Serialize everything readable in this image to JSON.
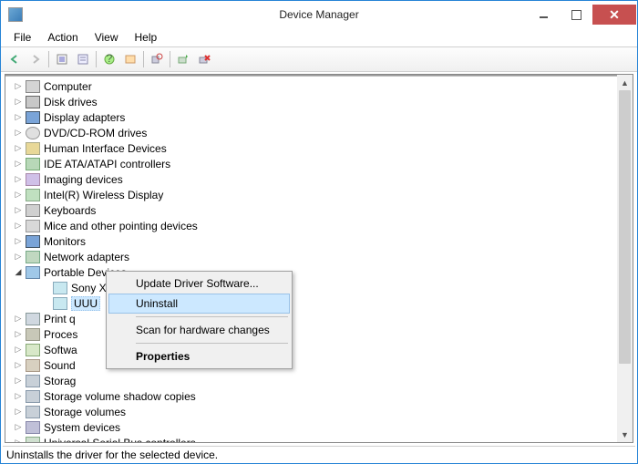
{
  "window": {
    "title": "Device Manager"
  },
  "menu": {
    "file": "File",
    "action": "Action",
    "view": "View",
    "help": "Help"
  },
  "tree": {
    "items": [
      {
        "label": "Computer",
        "icon": "ic-comp",
        "level": 0,
        "expanded": false
      },
      {
        "label": "Disk drives",
        "icon": "ic-disk",
        "level": 0,
        "expanded": false
      },
      {
        "label": "Display adapters",
        "icon": "ic-disp",
        "level": 0,
        "expanded": false
      },
      {
        "label": "DVD/CD-ROM drives",
        "icon": "ic-dvd",
        "level": 0,
        "expanded": false
      },
      {
        "label": "Human Interface Devices",
        "icon": "ic-hid",
        "level": 0,
        "expanded": false
      },
      {
        "label": "IDE ATA/ATAPI controllers",
        "icon": "ic-ide",
        "level": 0,
        "expanded": false
      },
      {
        "label": "Imaging devices",
        "icon": "ic-img",
        "level": 0,
        "expanded": false
      },
      {
        "label": "Intel(R) Wireless Display",
        "icon": "ic-wifi",
        "level": 0,
        "expanded": false
      },
      {
        "label": "Keyboards",
        "icon": "ic-kb",
        "level": 0,
        "expanded": false
      },
      {
        "label": "Mice and other pointing devices",
        "icon": "ic-mouse",
        "level": 0,
        "expanded": false
      },
      {
        "label": "Monitors",
        "icon": "ic-mon",
        "level": 0,
        "expanded": false
      },
      {
        "label": "Network adapters",
        "icon": "ic-net",
        "level": 0,
        "expanded": false
      },
      {
        "label": "Portable Devices",
        "icon": "ic-port",
        "level": 0,
        "expanded": true
      },
      {
        "label": "Sony Xperia J",
        "icon": "ic-phone",
        "level": 1,
        "expanded": null
      },
      {
        "label": "UUU",
        "icon": "ic-phone",
        "level": 1,
        "expanded": null,
        "selected": true
      },
      {
        "label": "Print q",
        "icon": "ic-prn",
        "level": 0,
        "expanded": false,
        "cut": true
      },
      {
        "label": "Proces",
        "icon": "ic-proc",
        "level": 0,
        "expanded": false,
        "cut": true
      },
      {
        "label": "Softwa",
        "icon": "ic-soft",
        "level": 0,
        "expanded": false,
        "cut": true
      },
      {
        "label": "Sound",
        "icon": "ic-snd",
        "level": 0,
        "expanded": false,
        "cut": true
      },
      {
        "label": "Storag",
        "icon": "ic-stor",
        "level": 0,
        "expanded": false,
        "cut": true
      },
      {
        "label": "Storage volume shadow copies",
        "icon": "ic-stor",
        "level": 0,
        "expanded": false
      },
      {
        "label": "Storage volumes",
        "icon": "ic-stor",
        "level": 0,
        "expanded": false
      },
      {
        "label": "System devices",
        "icon": "ic-sys",
        "level": 0,
        "expanded": false
      },
      {
        "label": "Universal Serial Bus controllers",
        "icon": "ic-usb",
        "level": 0,
        "expanded": false
      }
    ]
  },
  "context_menu": {
    "items": [
      {
        "label": "Update Driver Software...",
        "type": "item"
      },
      {
        "label": "Uninstall",
        "type": "item",
        "hover": true
      },
      {
        "type": "sep"
      },
      {
        "label": "Scan for hardware changes",
        "type": "item"
      },
      {
        "type": "sep"
      },
      {
        "label": "Properties",
        "type": "item",
        "bold": true
      }
    ]
  },
  "statusbar": {
    "text": "Uninstalls the driver for the selected device."
  }
}
